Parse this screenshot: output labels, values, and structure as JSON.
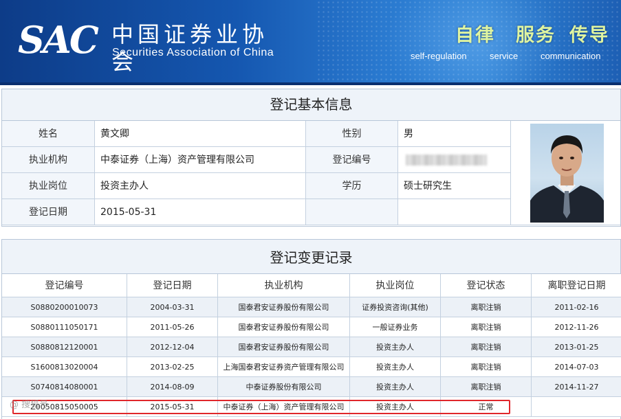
{
  "header": {
    "logo_text": "SAC",
    "org_name_cn": "中国证券业协会",
    "org_name_en": "Securities Association of China",
    "slogans": [
      {
        "cn": "自律",
        "en": "self-regulation"
      },
      {
        "cn": "服务",
        "en": "service"
      },
      {
        "cn": "传导",
        "en": "communication"
      }
    ]
  },
  "basic_info": {
    "title": "登记基本信息",
    "name_label": "姓名",
    "name_value": "黄文卿",
    "gender_label": "性别",
    "gender_value": "男",
    "org_label": "执业机构",
    "org_value": "中泰证券（上海）资产管理有限公司",
    "reg_no_label": "登记编号",
    "reg_no_value": "",
    "position_label": "执业岗位",
    "position_value": "投资主办人",
    "education_label": "学历",
    "education_value": "硕士研究生",
    "reg_date_label": "登记日期",
    "reg_date_value": "2015-05-31"
  },
  "change_records": {
    "title": "登记变更记录",
    "columns": [
      "登记编号",
      "登记日期",
      "执业机构",
      "执业岗位",
      "登记状态",
      "离职登记日期"
    ],
    "rows": [
      [
        "S0880200010073",
        "2004-03-31",
        "国泰君安证券股份有限公司",
        "证券投资咨询(其他)",
        "离职注销",
        "2011-02-16"
      ],
      [
        "S0880111050171",
        "2011-05-26",
        "国泰君安证券股份有限公司",
        "一般证券业务",
        "离职注销",
        "2012-11-26"
      ],
      [
        "S0880812120001",
        "2012-12-04",
        "国泰君安证券股份有限公司",
        "投资主办人",
        "离职注销",
        "2013-01-25"
      ],
      [
        "S1600813020004",
        "2013-02-25",
        "上海国泰君安证券资产管理有限公司",
        "投资主办人",
        "离职注销",
        "2014-07-03"
      ],
      [
        "S0740814080001",
        "2014-08-09",
        "中泰证券股份有限公司",
        "投资主办人",
        "离职注销",
        "2014-11-27"
      ],
      [
        "Z0050815050005",
        "2015-05-31",
        "中泰证券（上海）资产管理有限公司",
        "投资主办人",
        "正常",
        ""
      ]
    ]
  },
  "watermark": "@ 搜狐号",
  "colors": {
    "banner_blue": "#1557b0",
    "slogan_green": "#dff4a0",
    "highlight_red": "#e0262b",
    "row_alt": "#ecf1f7"
  }
}
